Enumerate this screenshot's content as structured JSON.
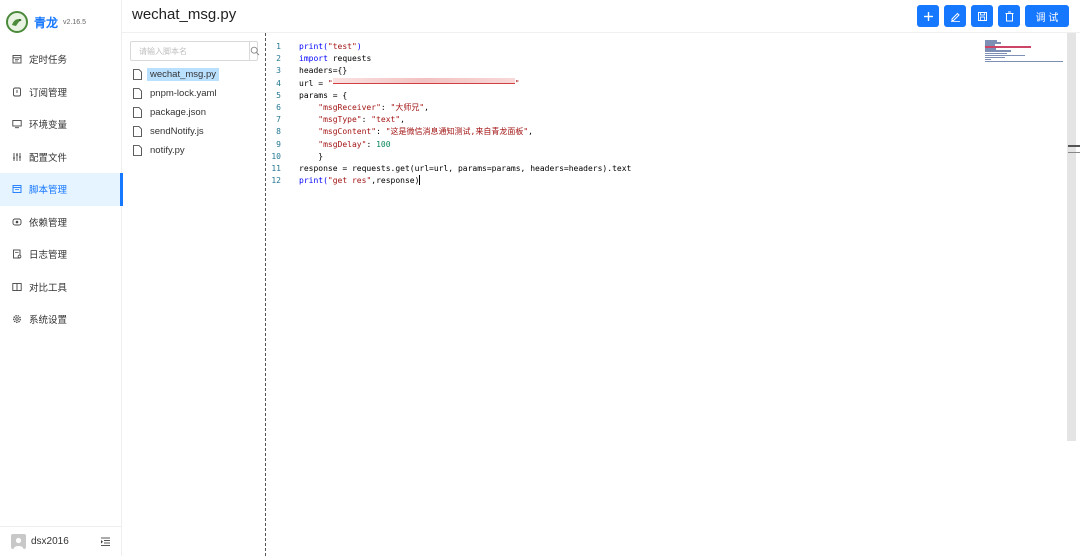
{
  "app": {
    "name": "青龙",
    "version": "v2.16.5"
  },
  "menu": [
    {
      "label": "定时任务",
      "icon": "calendar-icon"
    },
    {
      "label": "订阅管理",
      "icon": "subscription-icon"
    },
    {
      "label": "环境变量",
      "icon": "desktop-icon"
    },
    {
      "label": "配置文件",
      "icon": "sliders-icon"
    },
    {
      "label": "脚本管理",
      "icon": "script-icon",
      "active": true
    },
    {
      "label": "依赖管理",
      "icon": "dependency-icon"
    },
    {
      "label": "日志管理",
      "icon": "log-icon"
    },
    {
      "label": "对比工具",
      "icon": "diff-icon"
    },
    {
      "label": "系统设置",
      "icon": "gear-icon"
    }
  ],
  "user": {
    "name": "dsx2016"
  },
  "header": {
    "title": "wechat_msg.py",
    "debug_label": "调 试"
  },
  "search": {
    "placeholder": "请输入脚本名"
  },
  "files": [
    {
      "name": "wechat_msg.py",
      "selected": true
    },
    {
      "name": "pnpm-lock.yaml"
    },
    {
      "name": "package.json"
    },
    {
      "name": "sendNotify.js"
    },
    {
      "name": "notify.py"
    }
  ],
  "code": {
    "line_numbers": [
      "1",
      "2",
      "3",
      "4",
      "5",
      "6",
      "7",
      "8",
      "9",
      "10",
      "11",
      "12"
    ],
    "l1a": "print(",
    "l1b": "\"test\"",
    "l1c": ")",
    "l2a": "import",
    "l2b": " requests",
    "l3": "headers={}",
    "l4a": "url = ",
    "l4b": "\"",
    "l4c": "\"",
    "l5": "params = {",
    "l6a": "    ",
    "l6b": "\"msgReceiver\"",
    "l6c": ": ",
    "l6d": "\"大师兄\"",
    "l6e": ",",
    "l7a": "    ",
    "l7b": "\"msgType\"",
    "l7c": ": ",
    "l7d": "\"text\"",
    "l7e": ",",
    "l8a": "    ",
    "l8b": "\"msgContent\"",
    "l8c": ": ",
    "l8d": "\"这是微信消息通知测试,来自青龙面板\"",
    "l8e": ",",
    "l9a": "    ",
    "l9b": "\"msgDelay\"",
    "l9c": ": ",
    "l9d": "100",
    "l10": "    }",
    "l11": "response = requests.get(url=url, params=params, headers=headers).text",
    "l12a": "print(",
    "l12b": "\"get res\"",
    "l12c": ",response)"
  }
}
